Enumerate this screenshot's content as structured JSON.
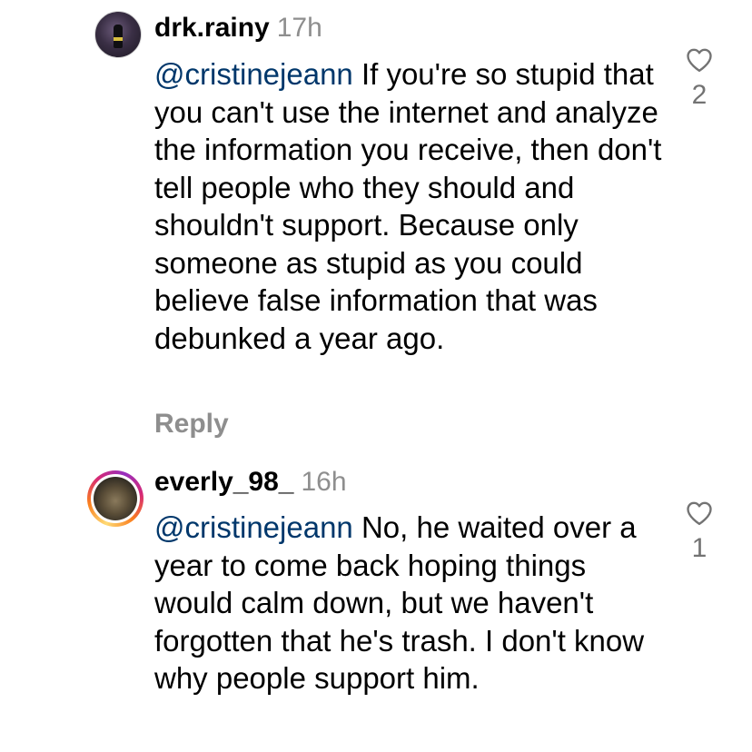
{
  "comments": [
    {
      "username": "drk.rainy",
      "time": "17h",
      "mention": "@cristinejeann",
      "text": " If you're so stupid that you can't use the internet and analyze the information you receive, then don't tell people who they should and shouldn't support. Because only someone as stupid as you could believe false information that was debunked a year ago.",
      "reply_label": "Reply",
      "likes": "2",
      "icon": "heart-outline-icon"
    },
    {
      "username": "everly_98_",
      "time": "16h",
      "mention": "@cristinejeann",
      "text": " No, he waited over a year to come back hoping things would calm down, but we haven't forgotten that he's trash. I don't know why people support him.",
      "likes": "1",
      "icon": "heart-outline-icon",
      "story_ring_colors": [
        "#feda75",
        "#fa7e1e",
        "#d62976",
        "#962fbf"
      ]
    }
  ],
  "colors": {
    "mention": "#00376b",
    "secondary_text": "#8e8e8e",
    "like_count": "#737373"
  }
}
